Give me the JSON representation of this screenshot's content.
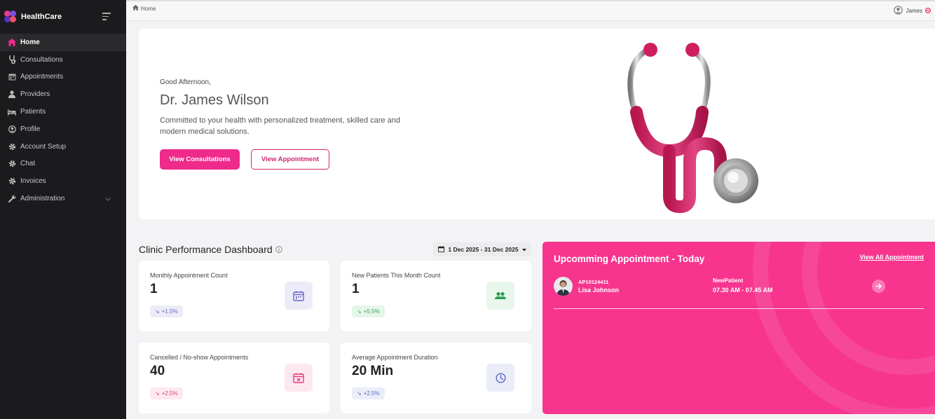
{
  "app": {
    "name": "HealthCare"
  },
  "sidebar": {
    "items": [
      {
        "label": "Home",
        "icon": "home-icon"
      },
      {
        "label": "Consultations",
        "icon": "stethoscope-icon"
      },
      {
        "label": "Appointments",
        "icon": "calendar-icon"
      },
      {
        "label": "Providers",
        "icon": "user-md-icon"
      },
      {
        "label": "Patients",
        "icon": "bed-icon"
      },
      {
        "label": "Profile",
        "icon": "user-circle-icon"
      },
      {
        "label": "Account Setup",
        "icon": "gear-icon"
      },
      {
        "label": "Chat",
        "icon": "gear-icon"
      },
      {
        "label": "Invoices",
        "icon": "gear-icon"
      },
      {
        "label": "Administration",
        "icon": "wrench-icon"
      }
    ]
  },
  "topbar": {
    "breadcrumb": "Home",
    "user": "James"
  },
  "hero": {
    "greeting": "Good Afternoon,",
    "name": "Dr. James Wilson",
    "tagline": "Committed to your health with personalized treatment, skilled care and modern medical solutions.",
    "primary_button": "View Consultations",
    "secondary_button": "View Appointment"
  },
  "dashboard": {
    "title": "Clinic Performance Dashboard",
    "date_range": "1 Dec 2025 - 31 Dec 2025",
    "cards": [
      {
        "label": "Monthly Appointment Count",
        "value": "1",
        "change": "+1.5%",
        "icon": "calendar-icon"
      },
      {
        "label": "New Patients This Month Count",
        "value": "1",
        "change": "+5.5%",
        "icon": "users-icon"
      },
      {
        "label": "Cancelled / No-show Appointments",
        "value": "40",
        "change": "+2.5%",
        "icon": "calendar-x-icon"
      },
      {
        "label": "Average Appointment Duration",
        "value": "20 Min",
        "change": "+2.5%",
        "icon": "clock-icon"
      }
    ]
  },
  "appointments": {
    "title": "Upcomming Appointment - Today",
    "view_all": "View All Appointment",
    "items": [
      {
        "id": "AP10124411",
        "patient": "Lisa Johnson",
        "type": "NewPatient",
        "time": "07.30 AM - 07.45 AM"
      }
    ]
  },
  "colors": {
    "accent": "#ee2a8a",
    "sidebar": "#1b1b1d",
    "appointment_panel": "#f7358f"
  }
}
